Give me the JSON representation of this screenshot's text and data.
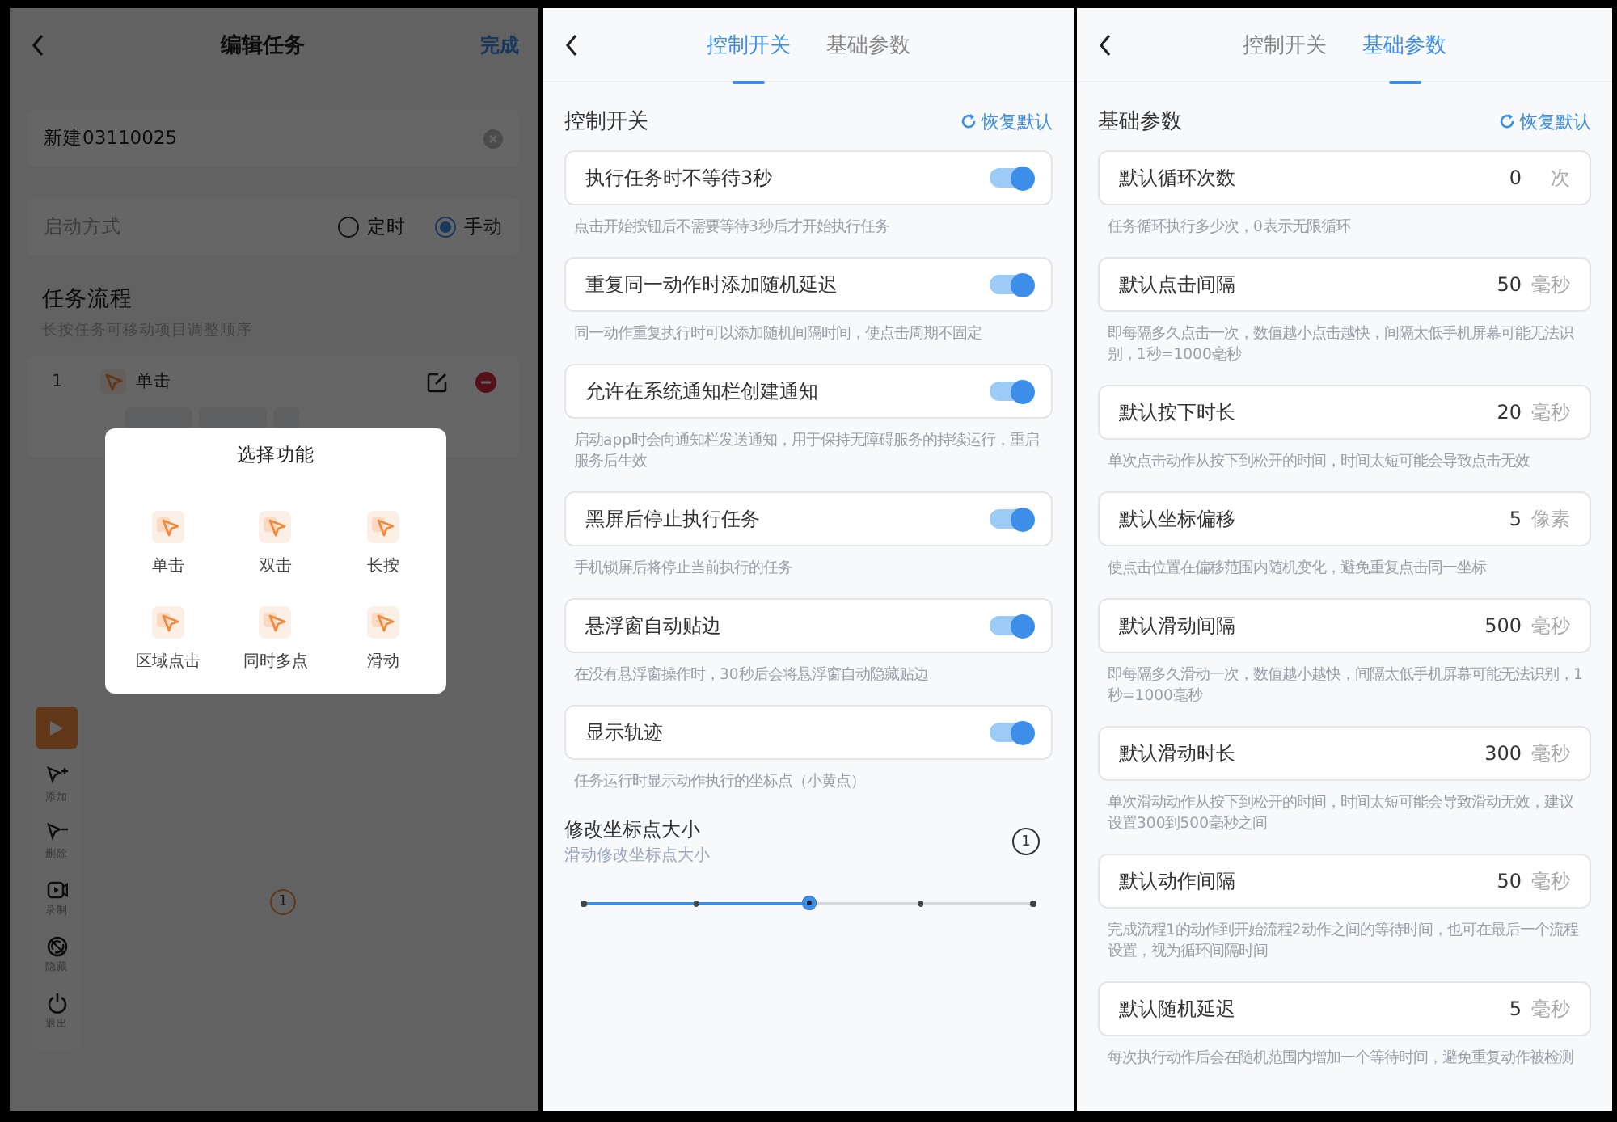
{
  "edit_screen": {
    "title": "编辑任务",
    "done": "完成",
    "name_field": {
      "value": "新建03110025"
    },
    "start_mode": {
      "label": "启动方式",
      "options": [
        {
          "label": "定时",
          "selected": false
        },
        {
          "label": "手动",
          "selected": true
        }
      ]
    },
    "flow": {
      "title": "任务流程",
      "hint": "长按任务可移动项目调整顺序",
      "tasks": [
        {
          "index": "1",
          "name": "单击"
        }
      ]
    },
    "toolbar": [
      {
        "kind": "add",
        "label": "添加"
      },
      {
        "kind": "remove",
        "label": "删除"
      },
      {
        "kind": "record",
        "label": "录制"
      },
      {
        "kind": "hide",
        "label": "隐藏"
      },
      {
        "kind": "exit",
        "label": "退出"
      }
    ],
    "marker": {
      "label": "1"
    },
    "dialog": {
      "title": "选择功能",
      "options": [
        {
          "label": "单击"
        },
        {
          "label": "双击"
        },
        {
          "label": "长按"
        },
        {
          "label": "区域点击"
        },
        {
          "label": "同时多点"
        },
        {
          "label": "滑动"
        }
      ]
    }
  },
  "control_screen": {
    "tabs": [
      {
        "label": "控制开关",
        "selected": true
      },
      {
        "label": "基础参数",
        "selected": false
      }
    ],
    "section_title": "控制开关",
    "reset": "恢复默认",
    "switches": [
      {
        "label": "执行任务时不等待3秒",
        "hint": "点击开始按钮后不需要等待3秒后才开始执行任务",
        "on": true
      },
      {
        "label": "重复同一动作时添加随机延迟",
        "hint": "同一动作重复执行时可以添加随机间隔时间，使点击周期不固定",
        "on": true
      },
      {
        "label": "允许在系统通知栏创建通知",
        "hint": "启动app时会向通知栏发送通知，用于保持无障碍服务的持续运行，重启服务后生效",
        "on": true
      },
      {
        "label": "黑屏后停止执行任务",
        "hint": "手机锁屏后将停止当前执行的任务",
        "on": true
      },
      {
        "label": "悬浮窗自动贴边",
        "hint": "在没有悬浮窗操作时，30秒后会将悬浮窗自动隐藏贴边",
        "on": true
      },
      {
        "label": "显示轨迹",
        "hint": "任务运行时显示动作执行的坐标点（小黄点）",
        "on": true
      }
    ],
    "size_setting": {
      "title": "修改坐标点大小",
      "hint": "滑动修改坐标点大小",
      "level": 0.5,
      "preview_label": "1"
    }
  },
  "params_screen": {
    "tabs": [
      {
        "label": "控制开关",
        "selected": false
      },
      {
        "label": "基础参数",
        "selected": true
      }
    ],
    "section_title": "基础参数",
    "reset": "恢复默认",
    "params": [
      {
        "label": "默认循环次数",
        "value": "0",
        "unit": "次",
        "hint": "任务循环执行多少次，0表示无限循环"
      },
      {
        "label": "默认点击间隔",
        "value": "50",
        "unit": "毫秒",
        "hint": "即每隔多久点击一次，数值越小点击越快，间隔太低手机屏幕可能无法识别，1秒=1000毫秒"
      },
      {
        "label": "默认按下时长",
        "value": "20",
        "unit": "毫秒",
        "hint": "单次点击动作从按下到松开的时间，时间太短可能会导致点击无效"
      },
      {
        "label": "默认坐标偏移",
        "value": "5",
        "unit": "像素",
        "hint": "使点击位置在偏移范围内随机变化，避免重复点击同一坐标"
      },
      {
        "label": "默认滑动间隔",
        "value": "500",
        "unit": "毫秒",
        "hint": "即每隔多久滑动一次，数值越小越快，间隔太低手机屏幕可能无法识别，1秒=1000毫秒"
      },
      {
        "label": "默认滑动时长",
        "value": "300",
        "unit": "毫秒",
        "hint": "单次滑动动作从按下到松开的时间，时间太短可能会导致滑动无效，建议设置300到500毫秒之间"
      },
      {
        "label": "默认动作间隔",
        "value": "50",
        "unit": "毫秒",
        "hint": "完成流程1的动作到开始流程2动作之间的等待时间，也可在最后一个流程设置，视为循环间隔时间"
      },
      {
        "label": "默认随机延迟",
        "value": "5",
        "unit": "毫秒",
        "hint": "每次执行动作后会在随机范围内增加一个等待时间，避免重复动作被检测"
      }
    ]
  }
}
